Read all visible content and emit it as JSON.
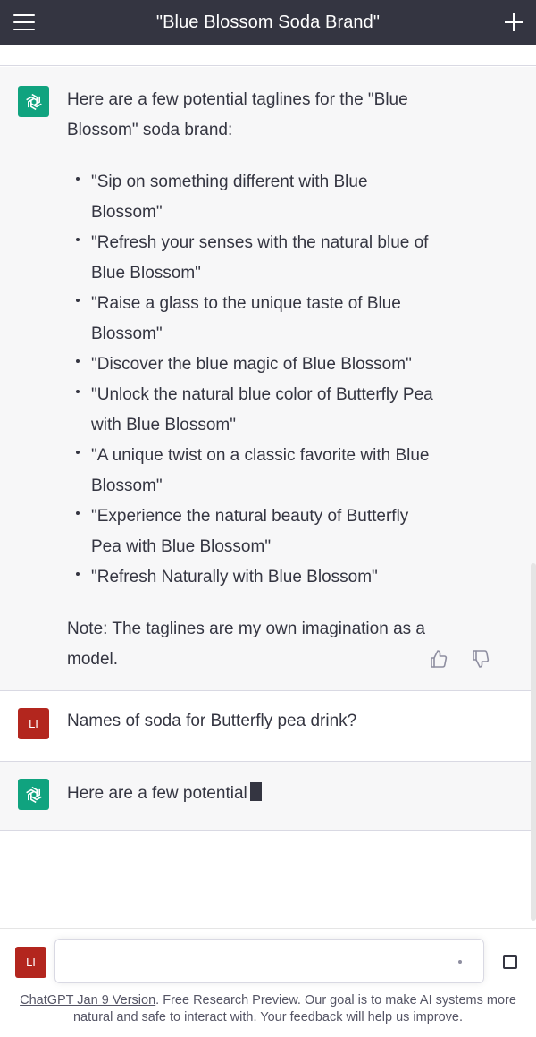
{
  "header": {
    "title": "\"Blue Blossom Soda Brand\"",
    "menu_icon": "hamburger-menu-icon",
    "new_chat_icon": "plus-icon"
  },
  "messages": [
    {
      "role": "assistant",
      "intro": "Here are a few potential taglines for the \"Blue Blossom\" soda brand:",
      "bullets": [
        "\"Sip on something different with Blue Blossom\"",
        "\"Refresh your senses with the natural blue of Blue Blossom\"",
        "\"Raise a glass to the unique taste of Blue Blossom\"",
        "\"Discover the blue magic of Blue Blossom\"",
        "\"Unlock the natural blue color of Butterfly Pea with Blue Blossom\"",
        "\"A unique twist on a classic favorite with Blue Blossom\"",
        "\"Experience the natural beauty of Butterfly Pea with Blue Blossom\"",
        "\"Refresh Naturally with Blue Blossom\""
      ],
      "note": "Note: The taglines are my own imagination as a model."
    },
    {
      "role": "user",
      "avatar_initials": "LI",
      "text": "Names of soda for Butterfly pea drink?"
    },
    {
      "role": "assistant",
      "text": "Here are a few potential"
    }
  ],
  "composer": {
    "avatar_initials": "LI",
    "value": ""
  },
  "footer": {
    "link_text": "ChatGPT Jan 9 Version",
    "text": ". Free Research Preview. Our goal is to make AI systems more natural and safe to interact with. Your feedback will help us improve."
  },
  "colors": {
    "header_bg": "#343541",
    "assistant_bg": "#f7f7f8",
    "gpt_avatar": "#10a37f",
    "user_avatar": "#b3261e"
  }
}
